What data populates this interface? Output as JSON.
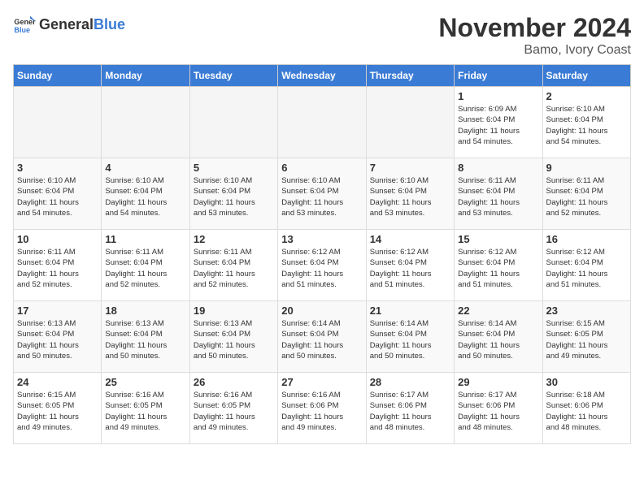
{
  "header": {
    "logo_general": "General",
    "logo_blue": "Blue",
    "month": "November 2024",
    "location": "Bamo, Ivory Coast"
  },
  "days_of_week": [
    "Sunday",
    "Monday",
    "Tuesday",
    "Wednesday",
    "Thursday",
    "Friday",
    "Saturday"
  ],
  "weeks": [
    {
      "days": [
        {
          "num": "",
          "info": "",
          "empty": true
        },
        {
          "num": "",
          "info": "",
          "empty": true
        },
        {
          "num": "",
          "info": "",
          "empty": true
        },
        {
          "num": "",
          "info": "",
          "empty": true
        },
        {
          "num": "",
          "info": "",
          "empty": true
        },
        {
          "num": "1",
          "info": "Sunrise: 6:09 AM\nSunset: 6:04 PM\nDaylight: 11 hours\nand 54 minutes."
        },
        {
          "num": "2",
          "info": "Sunrise: 6:10 AM\nSunset: 6:04 PM\nDaylight: 11 hours\nand 54 minutes."
        }
      ]
    },
    {
      "days": [
        {
          "num": "3",
          "info": "Sunrise: 6:10 AM\nSunset: 6:04 PM\nDaylight: 11 hours\nand 54 minutes."
        },
        {
          "num": "4",
          "info": "Sunrise: 6:10 AM\nSunset: 6:04 PM\nDaylight: 11 hours\nand 54 minutes."
        },
        {
          "num": "5",
          "info": "Sunrise: 6:10 AM\nSunset: 6:04 PM\nDaylight: 11 hours\nand 53 minutes."
        },
        {
          "num": "6",
          "info": "Sunrise: 6:10 AM\nSunset: 6:04 PM\nDaylight: 11 hours\nand 53 minutes."
        },
        {
          "num": "7",
          "info": "Sunrise: 6:10 AM\nSunset: 6:04 PM\nDaylight: 11 hours\nand 53 minutes."
        },
        {
          "num": "8",
          "info": "Sunrise: 6:11 AM\nSunset: 6:04 PM\nDaylight: 11 hours\nand 53 minutes."
        },
        {
          "num": "9",
          "info": "Sunrise: 6:11 AM\nSunset: 6:04 PM\nDaylight: 11 hours\nand 52 minutes."
        }
      ]
    },
    {
      "days": [
        {
          "num": "10",
          "info": "Sunrise: 6:11 AM\nSunset: 6:04 PM\nDaylight: 11 hours\nand 52 minutes."
        },
        {
          "num": "11",
          "info": "Sunrise: 6:11 AM\nSunset: 6:04 PM\nDaylight: 11 hours\nand 52 minutes."
        },
        {
          "num": "12",
          "info": "Sunrise: 6:11 AM\nSunset: 6:04 PM\nDaylight: 11 hours\nand 52 minutes."
        },
        {
          "num": "13",
          "info": "Sunrise: 6:12 AM\nSunset: 6:04 PM\nDaylight: 11 hours\nand 51 minutes."
        },
        {
          "num": "14",
          "info": "Sunrise: 6:12 AM\nSunset: 6:04 PM\nDaylight: 11 hours\nand 51 minutes."
        },
        {
          "num": "15",
          "info": "Sunrise: 6:12 AM\nSunset: 6:04 PM\nDaylight: 11 hours\nand 51 minutes."
        },
        {
          "num": "16",
          "info": "Sunrise: 6:12 AM\nSunset: 6:04 PM\nDaylight: 11 hours\nand 51 minutes."
        }
      ]
    },
    {
      "days": [
        {
          "num": "17",
          "info": "Sunrise: 6:13 AM\nSunset: 6:04 PM\nDaylight: 11 hours\nand 50 minutes."
        },
        {
          "num": "18",
          "info": "Sunrise: 6:13 AM\nSunset: 6:04 PM\nDaylight: 11 hours\nand 50 minutes."
        },
        {
          "num": "19",
          "info": "Sunrise: 6:13 AM\nSunset: 6:04 PM\nDaylight: 11 hours\nand 50 minutes."
        },
        {
          "num": "20",
          "info": "Sunrise: 6:14 AM\nSunset: 6:04 PM\nDaylight: 11 hours\nand 50 minutes."
        },
        {
          "num": "21",
          "info": "Sunrise: 6:14 AM\nSunset: 6:04 PM\nDaylight: 11 hours\nand 50 minutes."
        },
        {
          "num": "22",
          "info": "Sunrise: 6:14 AM\nSunset: 6:04 PM\nDaylight: 11 hours\nand 50 minutes."
        },
        {
          "num": "23",
          "info": "Sunrise: 6:15 AM\nSunset: 6:05 PM\nDaylight: 11 hours\nand 49 minutes."
        }
      ]
    },
    {
      "days": [
        {
          "num": "24",
          "info": "Sunrise: 6:15 AM\nSunset: 6:05 PM\nDaylight: 11 hours\nand 49 minutes."
        },
        {
          "num": "25",
          "info": "Sunrise: 6:16 AM\nSunset: 6:05 PM\nDaylight: 11 hours\nand 49 minutes."
        },
        {
          "num": "26",
          "info": "Sunrise: 6:16 AM\nSunset: 6:05 PM\nDaylight: 11 hours\nand 49 minutes."
        },
        {
          "num": "27",
          "info": "Sunrise: 6:16 AM\nSunset: 6:06 PM\nDaylight: 11 hours\nand 49 minutes."
        },
        {
          "num": "28",
          "info": "Sunrise: 6:17 AM\nSunset: 6:06 PM\nDaylight: 11 hours\nand 48 minutes."
        },
        {
          "num": "29",
          "info": "Sunrise: 6:17 AM\nSunset: 6:06 PM\nDaylight: 11 hours\nand 48 minutes."
        },
        {
          "num": "30",
          "info": "Sunrise: 6:18 AM\nSunset: 6:06 PM\nDaylight: 11 hours\nand 48 minutes."
        }
      ]
    }
  ]
}
